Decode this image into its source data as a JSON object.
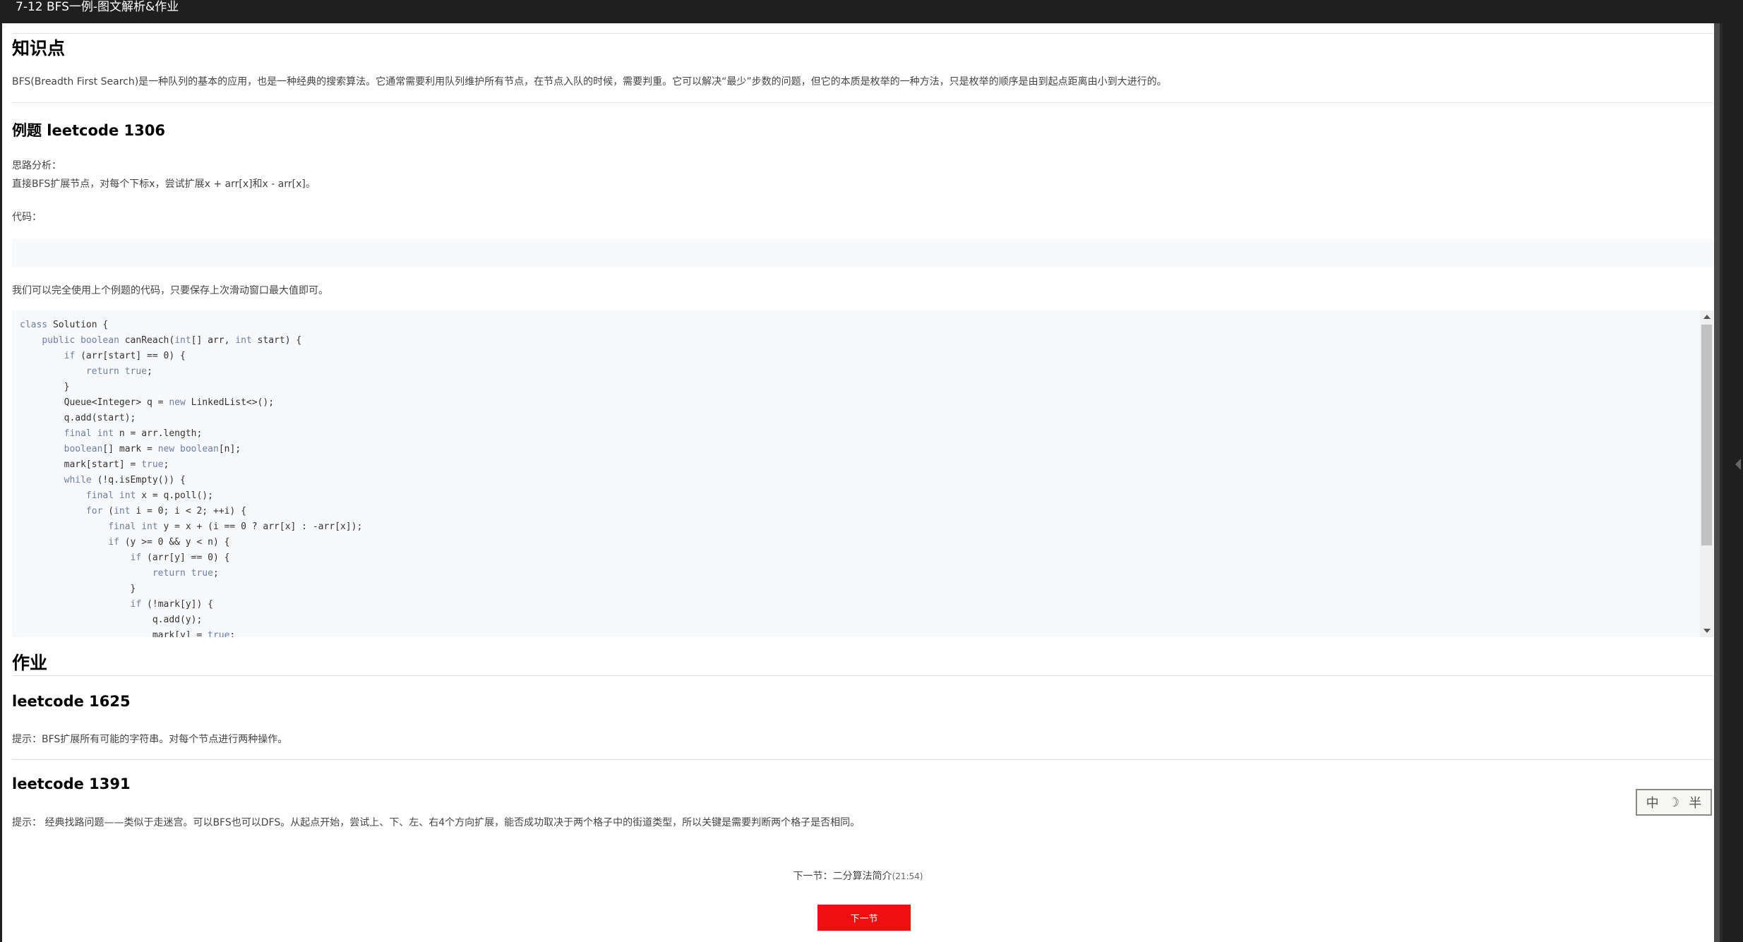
{
  "window": {
    "title": "7-12 BFS一例-图文解析&作业"
  },
  "knowledge": {
    "heading": "知识点",
    "text": "BFS(Breadth First Search)是一种队列的基本的应用，也是一种经典的搜索算法。它通常需要利用队列维护所有节点，在节点入队的时候，需要判重。它可以解决“最少”步数的问题，但它的本质是枚举的一种方法，只是枚举的顺序是由到起点距离由小到大进行的。"
  },
  "example": {
    "heading": "例题 leetcode 1306",
    "analysis_label": "思路分析：",
    "analysis_text": "直接BFS扩展节点，对每个下标x，尝试扩展x + arr[x]和x - arr[x]。",
    "code_label": "代码：",
    "note": "我们可以完全使用上个例题的代码，只要保存上次滑动窗口最大值即可。"
  },
  "code_lines": [
    "class Solution {",
    "    public boolean canReach(int[] arr, int start) {",
    "        if (arr[start] == 0) {",
    "            return true;",
    "        }",
    "        Queue<Integer> q = new LinkedList<>();",
    "        q.add(start);",
    "        final int n = arr.length;",
    "        boolean[] mark = new boolean[n];",
    "        mark[start] = true;",
    "        while (!q.isEmpty()) {",
    "            final int x = q.poll();",
    "            for (int i = 0; i < 2; ++i) {",
    "                final int y = x + (i == 0 ? arr[x] : -arr[x]);",
    "                if (y >= 0 && y < n) {",
    "                    if (arr[y] == 0) {",
    "                        return true;",
    "                    }",
    "                    if (!mark[y]) {",
    "                        q.add(y);",
    "                        mark[y] = true;"
  ],
  "homework": {
    "heading": "作业",
    "items": [
      {
        "title": "leetcode 1625",
        "hint": "提示：BFS扩展所有可能的字符串。对每个节点进行两种操作。"
      },
      {
        "title": "leetcode 1391",
        "hint": "提示： 经典找路问题——类似于走迷宫。可以BFS也可以DFS。从起点开始，尝试上、下、左、右4个方向扩展，能否成功取决于两个格子中的街道类型，所以关键是需要判断两个格子是否相同。"
      }
    ]
  },
  "ime": {
    "lang": "中",
    "mode": "☽",
    "width": "半"
  },
  "next": {
    "label": "下一节：二分算法简介",
    "duration": "(21:54)",
    "button": "下一节"
  }
}
